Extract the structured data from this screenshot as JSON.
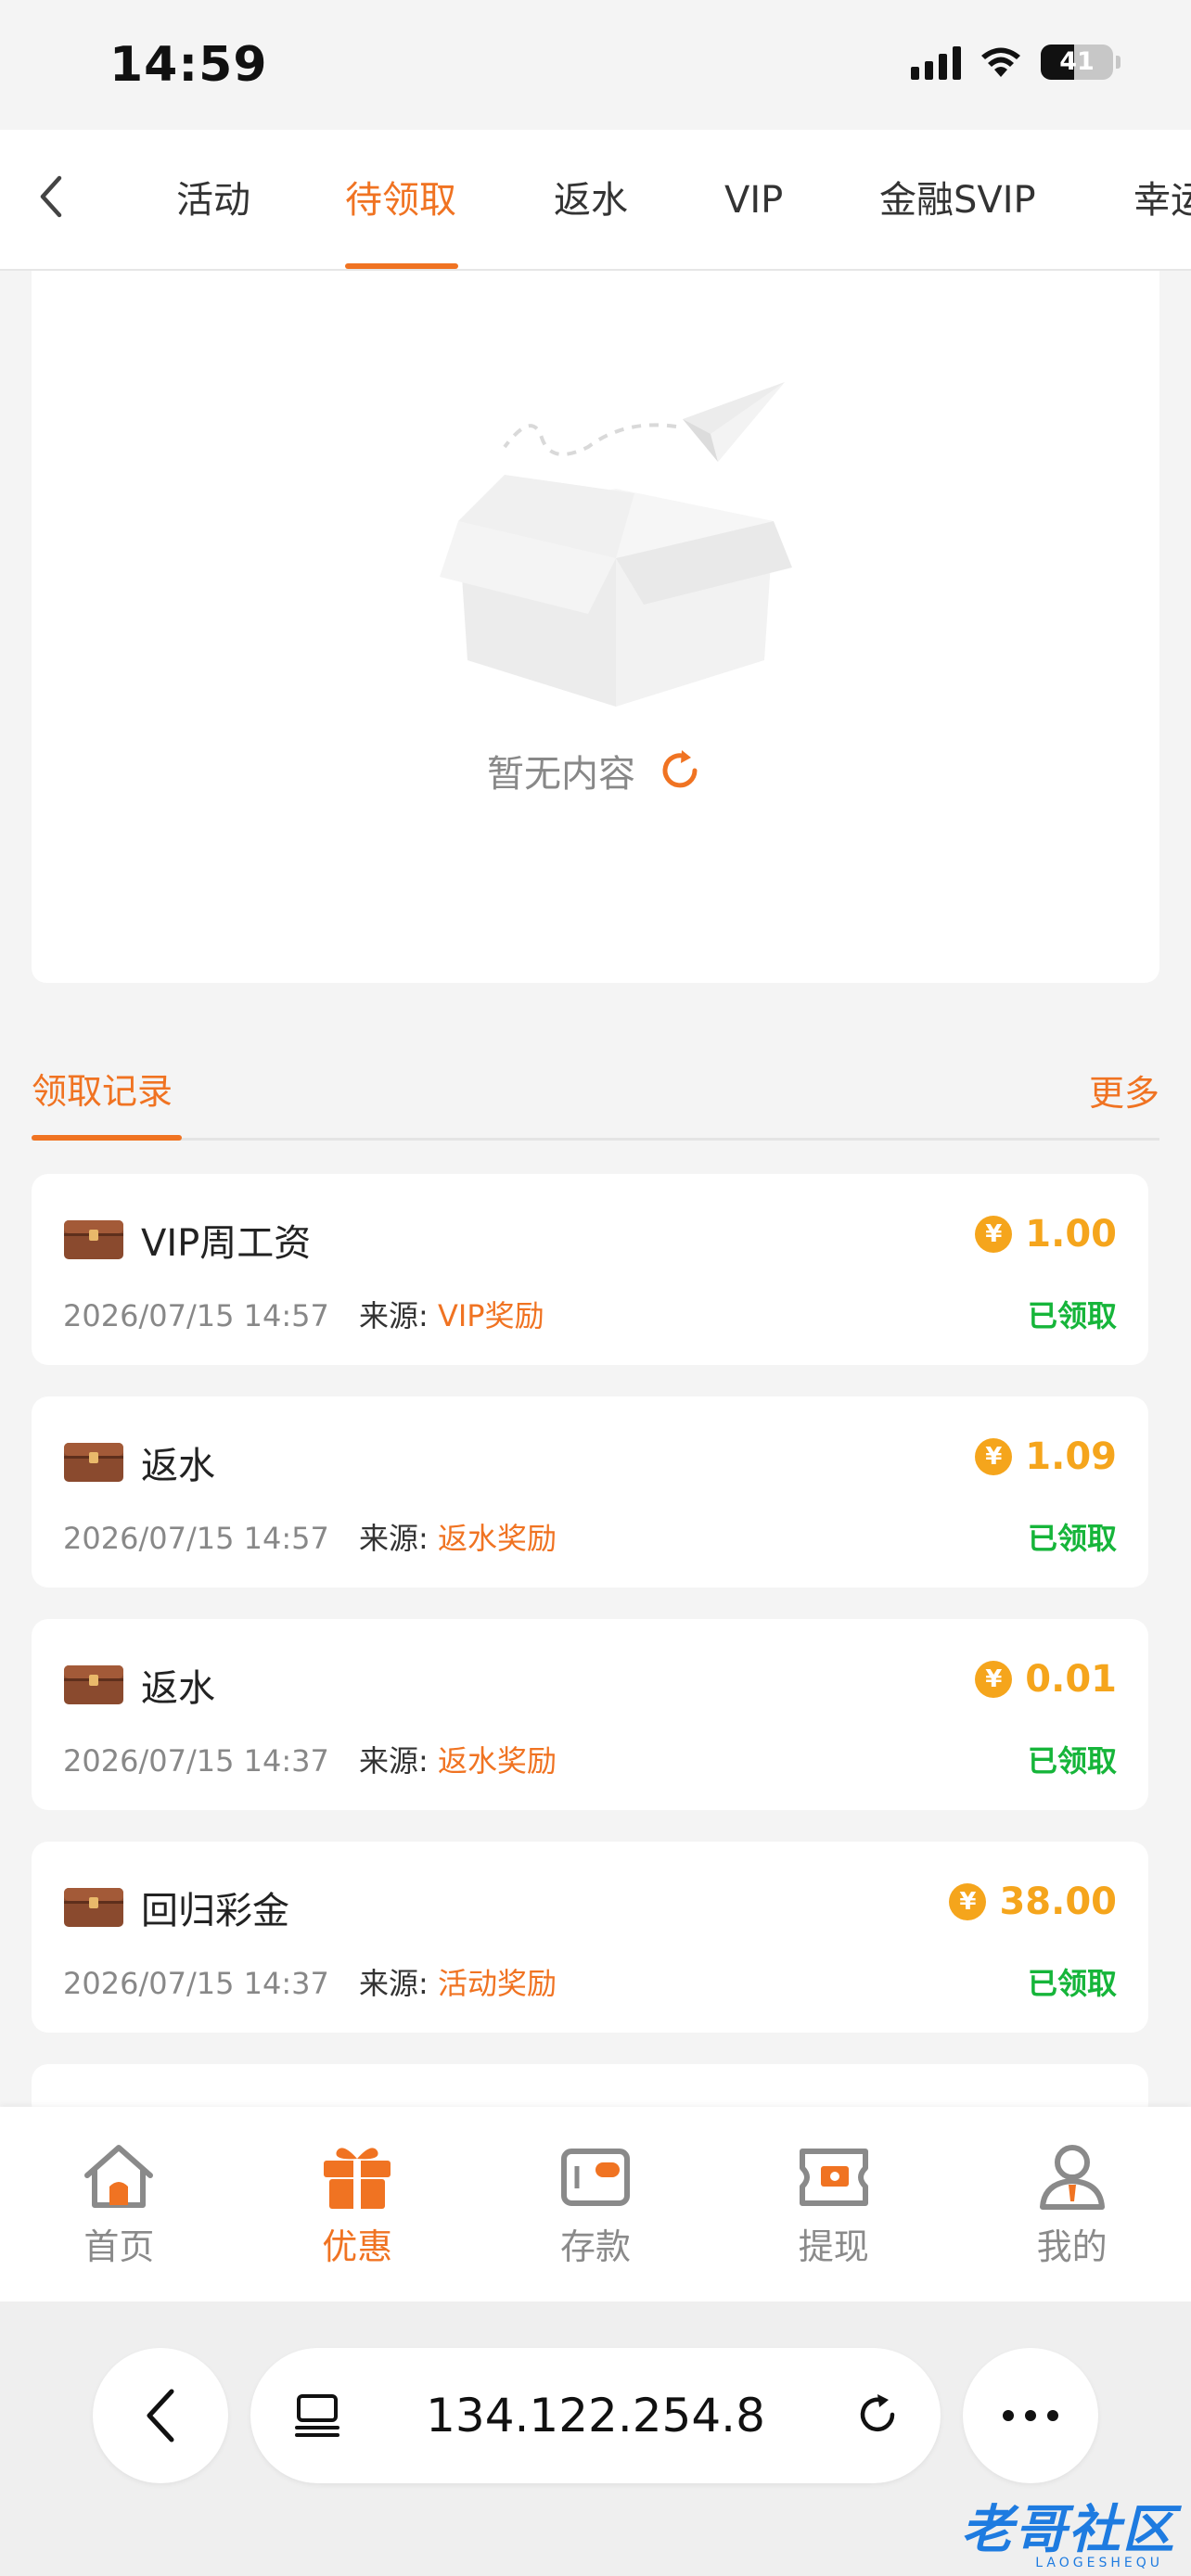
{
  "status": {
    "time": "14:59",
    "battery": "41"
  },
  "tabs": [
    {
      "label": "活动",
      "active": false
    },
    {
      "label": "待领取",
      "active": true
    },
    {
      "label": "返水",
      "active": false
    },
    {
      "label": "VIP",
      "active": false
    },
    {
      "label": "金融SVIP",
      "active": false
    },
    {
      "label": "幸运",
      "active": false
    }
  ],
  "empty": {
    "text": "暂无内容"
  },
  "records": {
    "title": "领取记录",
    "more": "更多",
    "source_label": "来源:",
    "items": [
      {
        "title": "VIP周工资",
        "amount": "1.00",
        "time": "2026/07/15 14:57",
        "source": "VIP奖励",
        "status": "已领取"
      },
      {
        "title": "返水",
        "amount": "1.09",
        "time": "2026/07/15 14:57",
        "source": "返水奖励",
        "status": "已领取"
      },
      {
        "title": "返水",
        "amount": "0.01",
        "time": "2026/07/15 14:37",
        "source": "返水奖励",
        "status": "已领取"
      },
      {
        "title": "回归彩金",
        "amount": "38.00",
        "time": "2026/07/15 14:37",
        "source": "活动奖励",
        "status": "已领取"
      }
    ]
  },
  "coin_symbol": "¥",
  "nav": [
    {
      "label": "首页",
      "icon": "home-icon",
      "active": false
    },
    {
      "label": "优惠",
      "icon": "gift-icon",
      "active": true
    },
    {
      "label": "存款",
      "icon": "wallet-icon",
      "active": false
    },
    {
      "label": "提现",
      "icon": "withdraw-icon",
      "active": false
    },
    {
      "label": "我的",
      "icon": "profile-icon",
      "active": false
    }
  ],
  "browser": {
    "url": "134.122.254.8"
  },
  "watermark": {
    "text": "老哥社区",
    "sub": "LAOGESHEQU"
  },
  "colors": {
    "accent": "#f07322",
    "coin": "#f5a51c",
    "claimed": "#16b53a"
  }
}
